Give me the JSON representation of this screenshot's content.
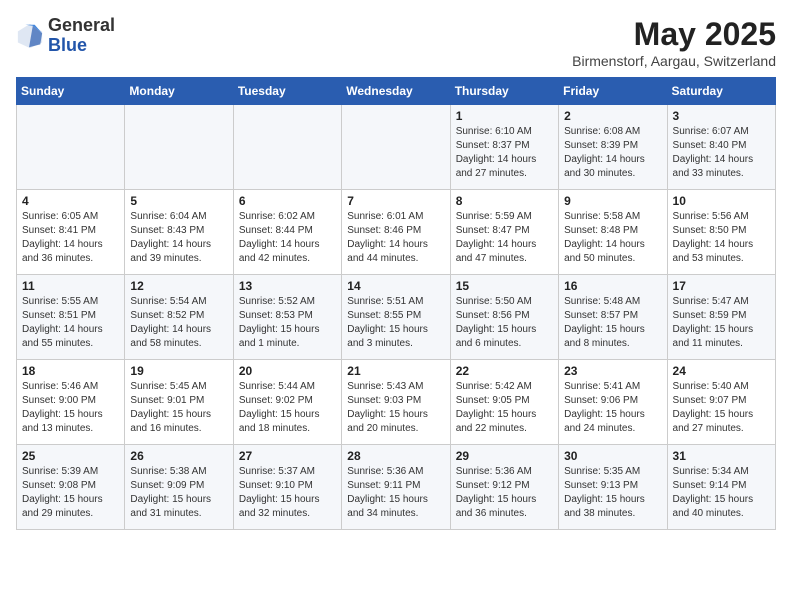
{
  "header": {
    "logo_general": "General",
    "logo_blue": "Blue",
    "month_year": "May 2025",
    "location": "Birmenstorf, Aargau, Switzerland"
  },
  "days_of_week": [
    "Sunday",
    "Monday",
    "Tuesday",
    "Wednesday",
    "Thursday",
    "Friday",
    "Saturday"
  ],
  "weeks": [
    [
      {
        "day": "",
        "info": ""
      },
      {
        "day": "",
        "info": ""
      },
      {
        "day": "",
        "info": ""
      },
      {
        "day": "",
        "info": ""
      },
      {
        "day": "1",
        "info": "Sunrise: 6:10 AM\nSunset: 8:37 PM\nDaylight: 14 hours\nand 27 minutes."
      },
      {
        "day": "2",
        "info": "Sunrise: 6:08 AM\nSunset: 8:39 PM\nDaylight: 14 hours\nand 30 minutes."
      },
      {
        "day": "3",
        "info": "Sunrise: 6:07 AM\nSunset: 8:40 PM\nDaylight: 14 hours\nand 33 minutes."
      }
    ],
    [
      {
        "day": "4",
        "info": "Sunrise: 6:05 AM\nSunset: 8:41 PM\nDaylight: 14 hours\nand 36 minutes."
      },
      {
        "day": "5",
        "info": "Sunrise: 6:04 AM\nSunset: 8:43 PM\nDaylight: 14 hours\nand 39 minutes."
      },
      {
        "day": "6",
        "info": "Sunrise: 6:02 AM\nSunset: 8:44 PM\nDaylight: 14 hours\nand 42 minutes."
      },
      {
        "day": "7",
        "info": "Sunrise: 6:01 AM\nSunset: 8:46 PM\nDaylight: 14 hours\nand 44 minutes."
      },
      {
        "day": "8",
        "info": "Sunrise: 5:59 AM\nSunset: 8:47 PM\nDaylight: 14 hours\nand 47 minutes."
      },
      {
        "day": "9",
        "info": "Sunrise: 5:58 AM\nSunset: 8:48 PM\nDaylight: 14 hours\nand 50 minutes."
      },
      {
        "day": "10",
        "info": "Sunrise: 5:56 AM\nSunset: 8:50 PM\nDaylight: 14 hours\nand 53 minutes."
      }
    ],
    [
      {
        "day": "11",
        "info": "Sunrise: 5:55 AM\nSunset: 8:51 PM\nDaylight: 14 hours\nand 55 minutes."
      },
      {
        "day": "12",
        "info": "Sunrise: 5:54 AM\nSunset: 8:52 PM\nDaylight: 14 hours\nand 58 minutes."
      },
      {
        "day": "13",
        "info": "Sunrise: 5:52 AM\nSunset: 8:53 PM\nDaylight: 15 hours\nand 1 minute."
      },
      {
        "day": "14",
        "info": "Sunrise: 5:51 AM\nSunset: 8:55 PM\nDaylight: 15 hours\nand 3 minutes."
      },
      {
        "day": "15",
        "info": "Sunrise: 5:50 AM\nSunset: 8:56 PM\nDaylight: 15 hours\nand 6 minutes."
      },
      {
        "day": "16",
        "info": "Sunrise: 5:48 AM\nSunset: 8:57 PM\nDaylight: 15 hours\nand 8 minutes."
      },
      {
        "day": "17",
        "info": "Sunrise: 5:47 AM\nSunset: 8:59 PM\nDaylight: 15 hours\nand 11 minutes."
      }
    ],
    [
      {
        "day": "18",
        "info": "Sunrise: 5:46 AM\nSunset: 9:00 PM\nDaylight: 15 hours\nand 13 minutes."
      },
      {
        "day": "19",
        "info": "Sunrise: 5:45 AM\nSunset: 9:01 PM\nDaylight: 15 hours\nand 16 minutes."
      },
      {
        "day": "20",
        "info": "Sunrise: 5:44 AM\nSunset: 9:02 PM\nDaylight: 15 hours\nand 18 minutes."
      },
      {
        "day": "21",
        "info": "Sunrise: 5:43 AM\nSunset: 9:03 PM\nDaylight: 15 hours\nand 20 minutes."
      },
      {
        "day": "22",
        "info": "Sunrise: 5:42 AM\nSunset: 9:05 PM\nDaylight: 15 hours\nand 22 minutes."
      },
      {
        "day": "23",
        "info": "Sunrise: 5:41 AM\nSunset: 9:06 PM\nDaylight: 15 hours\nand 24 minutes."
      },
      {
        "day": "24",
        "info": "Sunrise: 5:40 AM\nSunset: 9:07 PM\nDaylight: 15 hours\nand 27 minutes."
      }
    ],
    [
      {
        "day": "25",
        "info": "Sunrise: 5:39 AM\nSunset: 9:08 PM\nDaylight: 15 hours\nand 29 minutes."
      },
      {
        "day": "26",
        "info": "Sunrise: 5:38 AM\nSunset: 9:09 PM\nDaylight: 15 hours\nand 31 minutes."
      },
      {
        "day": "27",
        "info": "Sunrise: 5:37 AM\nSunset: 9:10 PM\nDaylight: 15 hours\nand 32 minutes."
      },
      {
        "day": "28",
        "info": "Sunrise: 5:36 AM\nSunset: 9:11 PM\nDaylight: 15 hours\nand 34 minutes."
      },
      {
        "day": "29",
        "info": "Sunrise: 5:36 AM\nSunset: 9:12 PM\nDaylight: 15 hours\nand 36 minutes."
      },
      {
        "day": "30",
        "info": "Sunrise: 5:35 AM\nSunset: 9:13 PM\nDaylight: 15 hours\nand 38 minutes."
      },
      {
        "day": "31",
        "info": "Sunrise: 5:34 AM\nSunset: 9:14 PM\nDaylight: 15 hours\nand 40 minutes."
      }
    ]
  ]
}
